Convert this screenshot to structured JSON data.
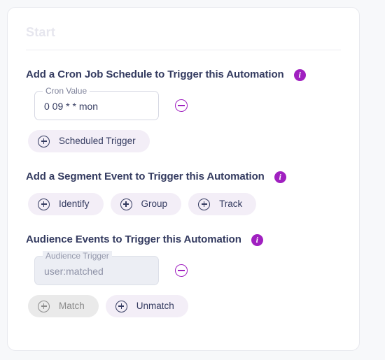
{
  "card": {
    "start_label": "Start"
  },
  "sections": [
    {
      "title": "Add a Cron Job Schedule to Trigger this Automation",
      "info_icon": "info-icon",
      "field": {
        "label": "Cron Value",
        "value": "0 09 * * mon",
        "remove_icon": "minus-circle-icon"
      },
      "chips": [
        {
          "label": "Scheduled Trigger",
          "icon": "plus-circle-icon",
          "disabled": false
        }
      ]
    },
    {
      "title": "Add a Segment Event to Trigger this Automation",
      "info_icon": "info-icon",
      "chips": [
        {
          "label": "Identify",
          "icon": "plus-circle-icon",
          "disabled": false
        },
        {
          "label": "Group",
          "icon": "plus-circle-icon",
          "disabled": false
        },
        {
          "label": "Track",
          "icon": "plus-circle-icon",
          "disabled": false
        }
      ]
    },
    {
      "title": "Audience Events to Trigger this Automation",
      "info_icon": "info-icon",
      "field": {
        "label": "Audience Trigger",
        "value": "user:matched",
        "disabled": true,
        "remove_icon": "minus-circle-icon"
      },
      "chips": [
        {
          "label": "Match",
          "icon": "plus-circle-icon",
          "disabled": true
        },
        {
          "label": "Unmatch",
          "icon": "plus-circle-icon",
          "disabled": false
        }
      ]
    }
  ],
  "colors": {
    "accent_purple": "#a020c0",
    "text_navy": "#343b60",
    "chip_lavender": "#f3eef7",
    "chip_disabled": "#eaeaea",
    "field_disabled_bg": "#eceef4"
  }
}
